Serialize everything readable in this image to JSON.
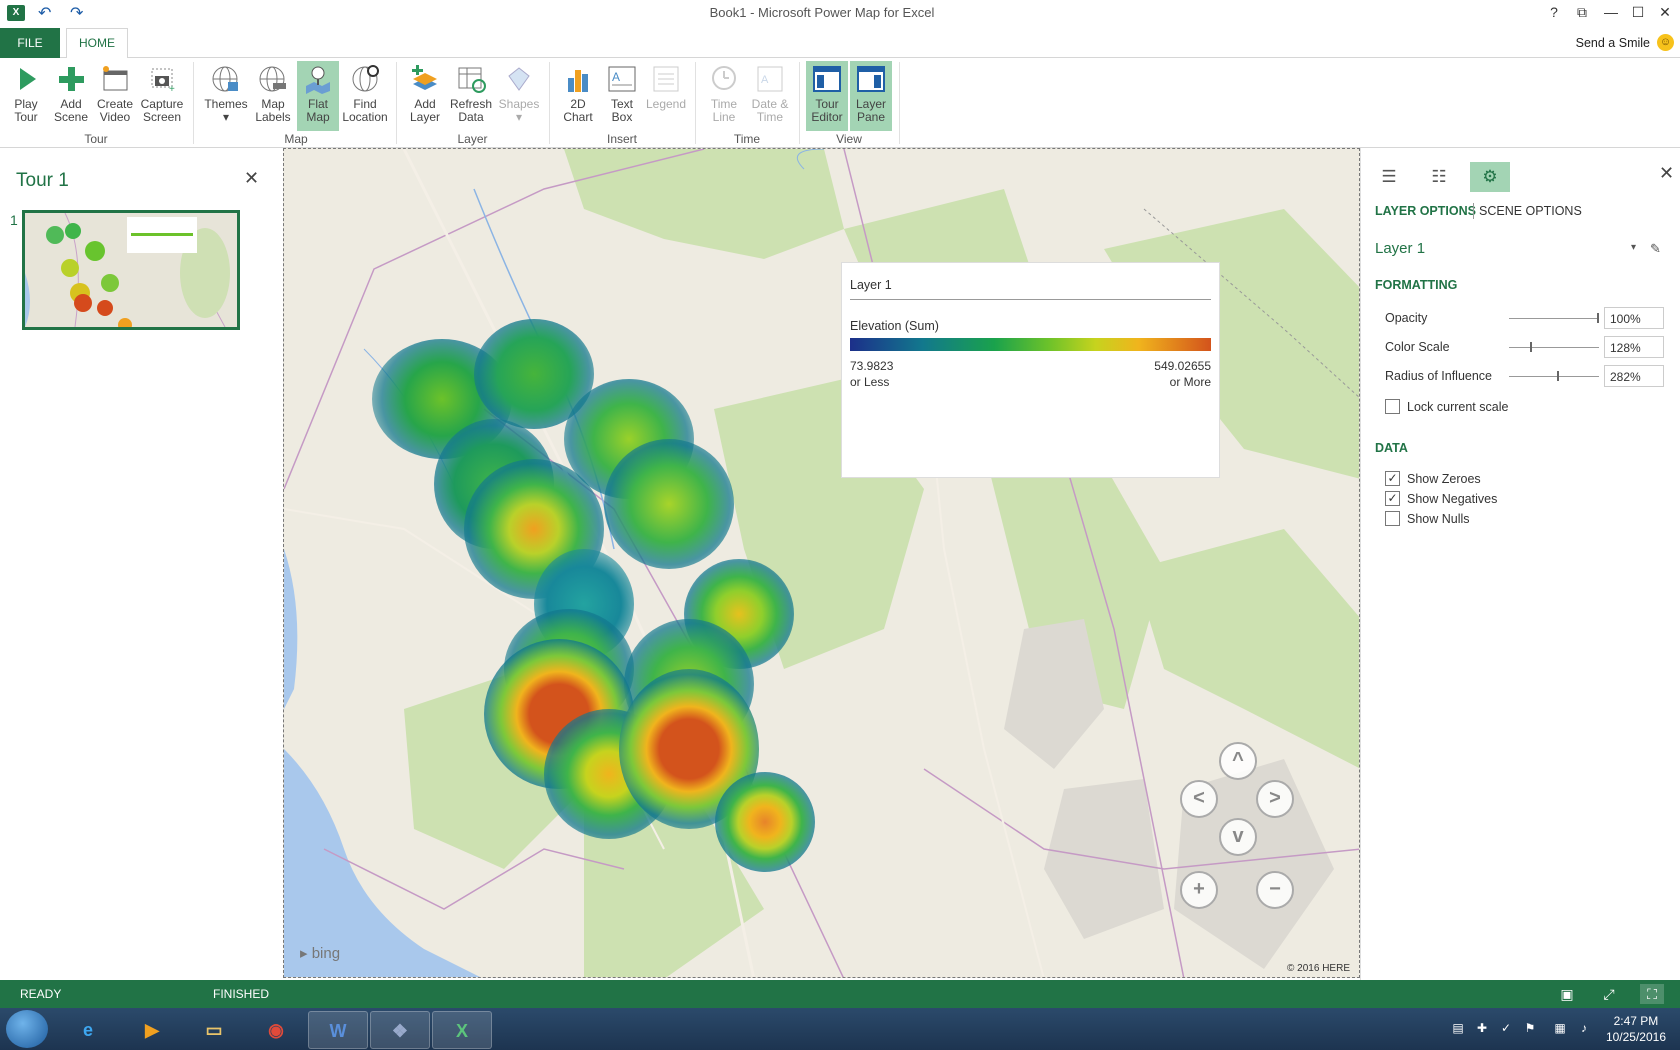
{
  "titlebar": {
    "title": "Book1 - Microsoft Power Map for Excel",
    "app_icon": "X",
    "undo_icon": "undo-icon",
    "redo_icon": "redo-icon",
    "help_label": "?",
    "min_label": "—",
    "max_label": "☐",
    "close_label": "✕",
    "restore_label": "⧉"
  },
  "tabs": {
    "file": "FILE",
    "home": "HOME",
    "send_smile": "Send a Smile"
  },
  "ribbon": {
    "buttons": {
      "play_tour": [
        "Play",
        "Tour"
      ],
      "add_scene": [
        "Add",
        "Scene"
      ],
      "create_video": [
        "Create",
        "Video"
      ],
      "capture_screen": [
        "Capture",
        "Screen"
      ],
      "themes": [
        "Themes",
        "▾"
      ],
      "map_labels": [
        "Map",
        "Labels"
      ],
      "flat_map": [
        "Flat",
        "Map"
      ],
      "find_location": [
        "Find",
        "Location"
      ],
      "add_layer": [
        "Add",
        "Layer"
      ],
      "refresh_data": [
        "Refresh",
        "Data"
      ],
      "shapes": [
        "Shapes",
        "▾"
      ],
      "chart_2d": [
        "2D",
        "Chart"
      ],
      "text_box": [
        "Text",
        "Box"
      ],
      "legend": [
        "Legend",
        ""
      ],
      "time_line": [
        "Time",
        "Line"
      ],
      "date_time": [
        "Date &",
        "Time"
      ],
      "tour_editor": [
        "Tour",
        "Editor"
      ],
      "layer_pane": [
        "Layer",
        "Pane"
      ]
    },
    "groups": {
      "tour": "Tour",
      "map": "Map",
      "layer": "Layer",
      "insert": "Insert",
      "time": "Time",
      "view": "View"
    }
  },
  "tour_pane": {
    "title": "Tour 1",
    "close": "✕",
    "scene_number": "1"
  },
  "map": {
    "legend": {
      "layer": "Layer 1",
      "field": "Elevation (Sum)",
      "min_value": "73.9823",
      "min_suffix": "or Less",
      "max_value": "549.02655",
      "max_suffix": "or More"
    },
    "nav": {
      "up": "^",
      "left": "<",
      "right": ">",
      "down": "v",
      "zoom_in": "+",
      "zoom_out": "−"
    },
    "bing": "bing",
    "copyright": "© 2016 HERE",
    "colors": {
      "low": "#1c2f8a",
      "mid": "#6cc22a",
      "high": "#d3531c"
    }
  },
  "right_pane": {
    "tab_layers_icon": "layers-icon",
    "tab_fields_icon": "field-list-icon",
    "tab_settings_icon": "gear-icon",
    "close": "✕",
    "layer_options": "LAYER OPTIONS",
    "scene_options": "SCENE OPTIONS",
    "layer_name": "Layer 1",
    "formatting": "FORMATTING",
    "opacity_label": "Opacity",
    "opacity_value": "100%",
    "opacity_level": 1.0,
    "color_scale_label": "Color Scale",
    "color_scale_value": "128%",
    "radius_label": "Radius of Influence",
    "radius_value": "282%",
    "lock_scale_label": "Lock current scale",
    "data_head": "DATA",
    "show_zeroes": "Show Zeroes",
    "show_negatives": "Show Negatives",
    "show_nulls": "Show Nulls",
    "check_mark": "✓"
  },
  "statusbar": {
    "ready": "READY",
    "finished": "FINISHED"
  },
  "taskbar": {
    "time": "2:47 PM",
    "date": "10/25/2016"
  }
}
